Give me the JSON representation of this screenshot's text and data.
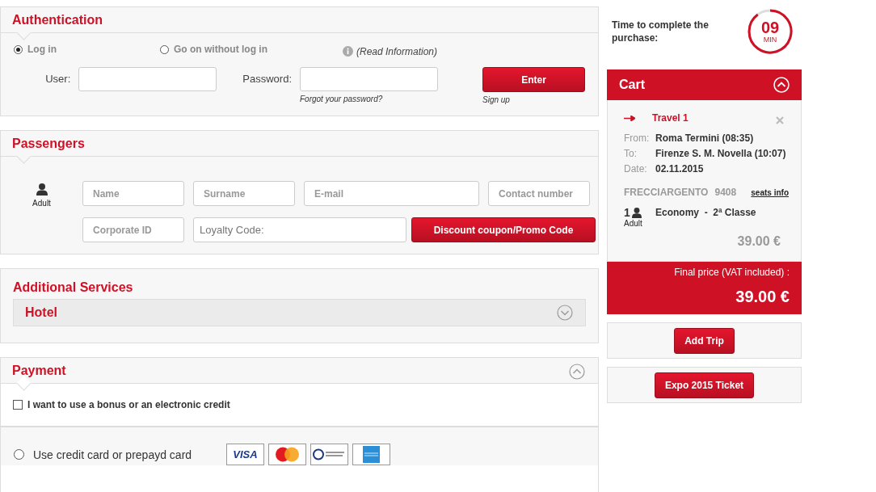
{
  "authentication": {
    "title": "Authentication",
    "options": [
      {
        "label": "Log in",
        "selected": true
      },
      {
        "label": "Go on without log in",
        "selected": false
      }
    ],
    "info_link": "(Read Information)",
    "user_label": "User:",
    "password_label": "Password:",
    "forgot_link": "Forgot your password?",
    "enter_button": "Enter",
    "signup_link": "Sign up"
  },
  "passengers": {
    "title": "Passengers",
    "passenger_type": "Adult",
    "fields": [
      {
        "placeholder": "Name"
      },
      {
        "placeholder": "Surname"
      },
      {
        "placeholder": "E-mail"
      },
      {
        "placeholder": "Contact number"
      },
      {
        "placeholder": "Corporate ID"
      },
      {
        "placeholder": "Loyalty Code:"
      }
    ],
    "promo_button": "Discount coupon/Promo Code"
  },
  "additional_services": {
    "title": "Additional Services",
    "items": [
      {
        "label": "Hotel",
        "expanded": false
      }
    ]
  },
  "payment": {
    "title": "Payment",
    "expanded": true,
    "bonus_checkbox": {
      "label": "I want to use a bonus or an electronic credit",
      "checked": false
    },
    "card_option": {
      "label": "Use credit card or prepayd card",
      "selected": false
    },
    "visa_logo": "VISA"
  },
  "timer": {
    "label": "Time to complete the purchase:",
    "value": "09",
    "unit": "MIN"
  },
  "cart": {
    "title": "Cart",
    "expanded": true,
    "travel": {
      "title": "Travel 1",
      "details": [
        {
          "label": "From:",
          "value": "Roma Termini (08:35)"
        },
        {
          "label": "To:",
          "value": "Firenze S. M. Novella (10:07)"
        },
        {
          "label": "Date:",
          "value": "02.11.2015"
        }
      ],
      "train": "FRECCIARGENTO",
      "train_number": "9408",
      "seats_link": "seats info",
      "passenger_count": "1",
      "passenger_type": "Adult",
      "fare": "Economy  -  2ª Classe",
      "price": "39.00 €"
    },
    "final_label": "Final price (VAT included) :",
    "final_price": "39.00 €"
  },
  "buttons": [
    "Add Trip",
    "Expo 2015 Ticket"
  ]
}
